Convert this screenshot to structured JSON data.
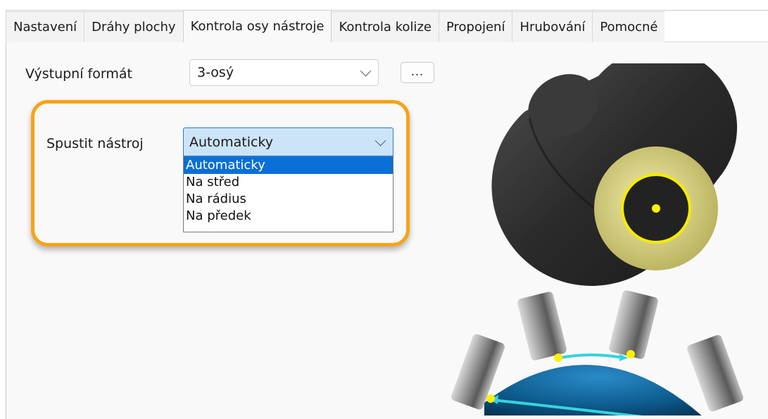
{
  "tabs": [
    {
      "label": "Nastavení"
    },
    {
      "label": "Dráhy plochy"
    },
    {
      "label": "Kontrola osy nástroje"
    },
    {
      "label": "Kontrola kolize"
    },
    {
      "label": "Propojení"
    },
    {
      "label": "Hrubování"
    },
    {
      "label": "Pomocné"
    }
  ],
  "active_tab": "Kontrola osy nástroje",
  "output_format": {
    "label": "Výstupní formát",
    "value": "3-osý",
    "more_button": "..."
  },
  "start_tool": {
    "label": "Spustit nástroj",
    "value": "Automaticky",
    "options": [
      "Automaticky",
      "Na střed",
      "Na rádius",
      "Na předek"
    ],
    "selected_option": "Automaticky"
  },
  "colors": {
    "highlight_border": "#f5a419",
    "selection": "#0a6fd6",
    "tool_tip": "#e6e18c",
    "marker": "#fff000",
    "dome": "#0d5b8e",
    "path_arrow": "#35d3dd"
  },
  "icons": [
    "chevron-down-icon",
    "tool-cylinder-illustration",
    "dome-tools-illustration"
  ]
}
